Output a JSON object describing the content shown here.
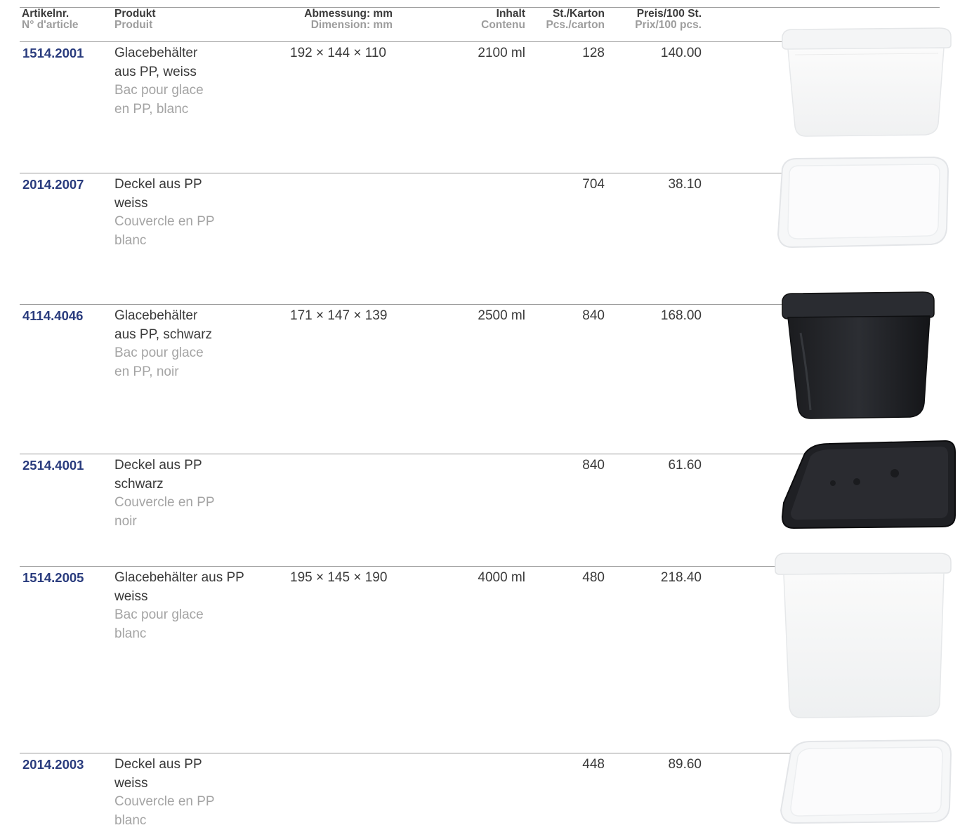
{
  "header": {
    "art_de": "Artikelnr.",
    "art_fr": "N° d'article",
    "prod_de": "Produkt",
    "prod_fr": "Produit",
    "dim_de": "Abmessung: mm",
    "dim_fr": "Dimension: mm",
    "vol_de": "Inhalt",
    "vol_fr": "Contenu",
    "qty_de": "St./Karton",
    "qty_fr": "Pcs./carton",
    "price_de": "Preis/100 St.",
    "price_fr": "Prix/100 pcs."
  },
  "rows": [
    {
      "art": "1514.2001",
      "de1": "Glacebehälter",
      "de2": "aus PP, weiss",
      "fr1": "Bac pour glace",
      "fr2": "en PP, blanc",
      "dim": "192 × 144 × 110",
      "vol": "2100 ml",
      "qty": "128",
      "price": "140.00",
      "image": "white-tub"
    },
    {
      "art": "2014.2007",
      "de1": "Deckel aus PP",
      "de2": "weiss",
      "fr1": "Couvercle en PP",
      "fr2": "blanc",
      "dim": "",
      "vol": "",
      "qty": "704",
      "price": "38.10",
      "image": "white-lid"
    },
    {
      "art": "4114.4046",
      "de1": "Glacebehälter",
      "de2": "aus PP, schwarz",
      "fr1": "Bac pour glace",
      "fr2": "en PP, noir",
      "dim": "171 × 147 × 139",
      "vol": "2500 ml",
      "qty": "840",
      "price": "168.00",
      "image": "black-tub"
    },
    {
      "art": "2514.4001",
      "de1": "Deckel aus PP",
      "de2": "schwarz",
      "fr1": "Couvercle en PP",
      "fr2": "noir",
      "dim": "",
      "vol": "",
      "qty": "840",
      "price": "61.60",
      "image": "black-lid"
    },
    {
      "art": "1514.2005",
      "de1": "Glacebehälter aus PP",
      "de2": "weiss",
      "fr1": "Bac pour glace",
      "fr2": "blanc",
      "dim": "195 × 145 × 190",
      "vol": "4000 ml",
      "qty": "480",
      "price": "218.40",
      "image": "white-tall-tub"
    },
    {
      "art": "2014.2003",
      "de1": "Deckel aus PP",
      "de2": "weiss",
      "fr1": "Couvercle en PP",
      "fr2": "blanc",
      "dim": "",
      "vol": "",
      "qty": "448",
      "price": "89.60",
      "image": "white-lid"
    }
  ],
  "colors": {
    "article_number": "#2a3c7e",
    "french_text": "#a4a4a4",
    "text": "#3a3a3a"
  }
}
